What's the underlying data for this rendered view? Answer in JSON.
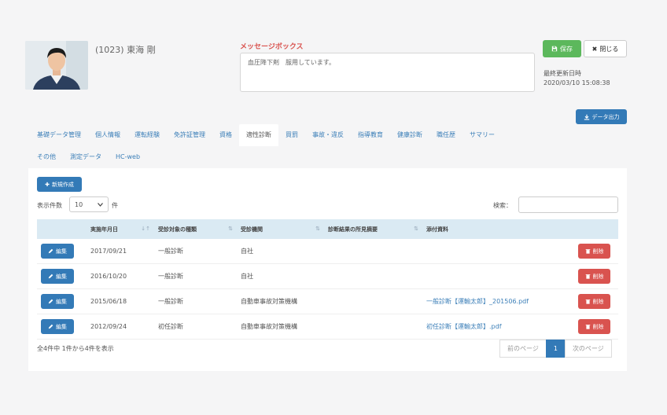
{
  "employee": {
    "name": "(1023) 東海 剛"
  },
  "message": {
    "label": "メッセージボックス",
    "text": "血圧降下剤　服用しています。"
  },
  "toolbar": {
    "save_label": "保存",
    "close_label": "閉じる"
  },
  "updated": {
    "label": "最終更新日時",
    "value": "2020/03/10 15:08:38"
  },
  "export_label": "データ出力",
  "tabs": {
    "row1": [
      "基礎データ管理",
      "個人情報",
      "運転経験",
      "免許証管理",
      "資格",
      "適性診断",
      "買罰",
      "事故・違反",
      "指導教育",
      "健康診断",
      "職任歴",
      "サマリー"
    ],
    "row2": [
      "その他",
      "測定データ",
      "HC-web"
    ],
    "active": "適性診断"
  },
  "list": {
    "new_label": "新規作成",
    "length_label": "表示件数",
    "length_value": "10",
    "length_unit": "件",
    "search_label": "検索："
  },
  "table": {
    "columns": [
      "実施年月日",
      "受診対象の種類",
      "受診機関",
      "診断結果の所見摘要",
      "添付資料"
    ],
    "edit_label": "編集",
    "delete_label": "削除",
    "rows": [
      {
        "date": "2017/09/21",
        "type": "一般診断",
        "institution": "自社",
        "note": "",
        "attachment": ""
      },
      {
        "date": "2016/10/20",
        "type": "一般診断",
        "institution": "自社",
        "note": "",
        "attachment": ""
      },
      {
        "date": "2015/06/18",
        "type": "一般診断",
        "institution": "自動車事故対策機構",
        "note": "",
        "attachment": "一般診断【運輸太郎】_201506.pdf"
      },
      {
        "date": "2012/09/24",
        "type": "初任診断",
        "institution": "自動車事故対策機構",
        "note": "",
        "attachment": "初任診断【運輸太郎】.pdf"
      }
    ]
  },
  "footer": {
    "info": "全4件中 1件から4件を表示",
    "prev_label": "前のページ",
    "page": "1",
    "next_label": "次のページ"
  },
  "colors": {
    "primary": "#337ab7",
    "success": "#5cb85c",
    "danger": "#d9534f",
    "header_bg": "#daeaf3"
  },
  "icons": {
    "save": "floppy-icon",
    "close": "x-icon",
    "export": "download-icon",
    "new": "plus-icon",
    "edit": "pencil-icon",
    "delete": "trash-icon"
  }
}
